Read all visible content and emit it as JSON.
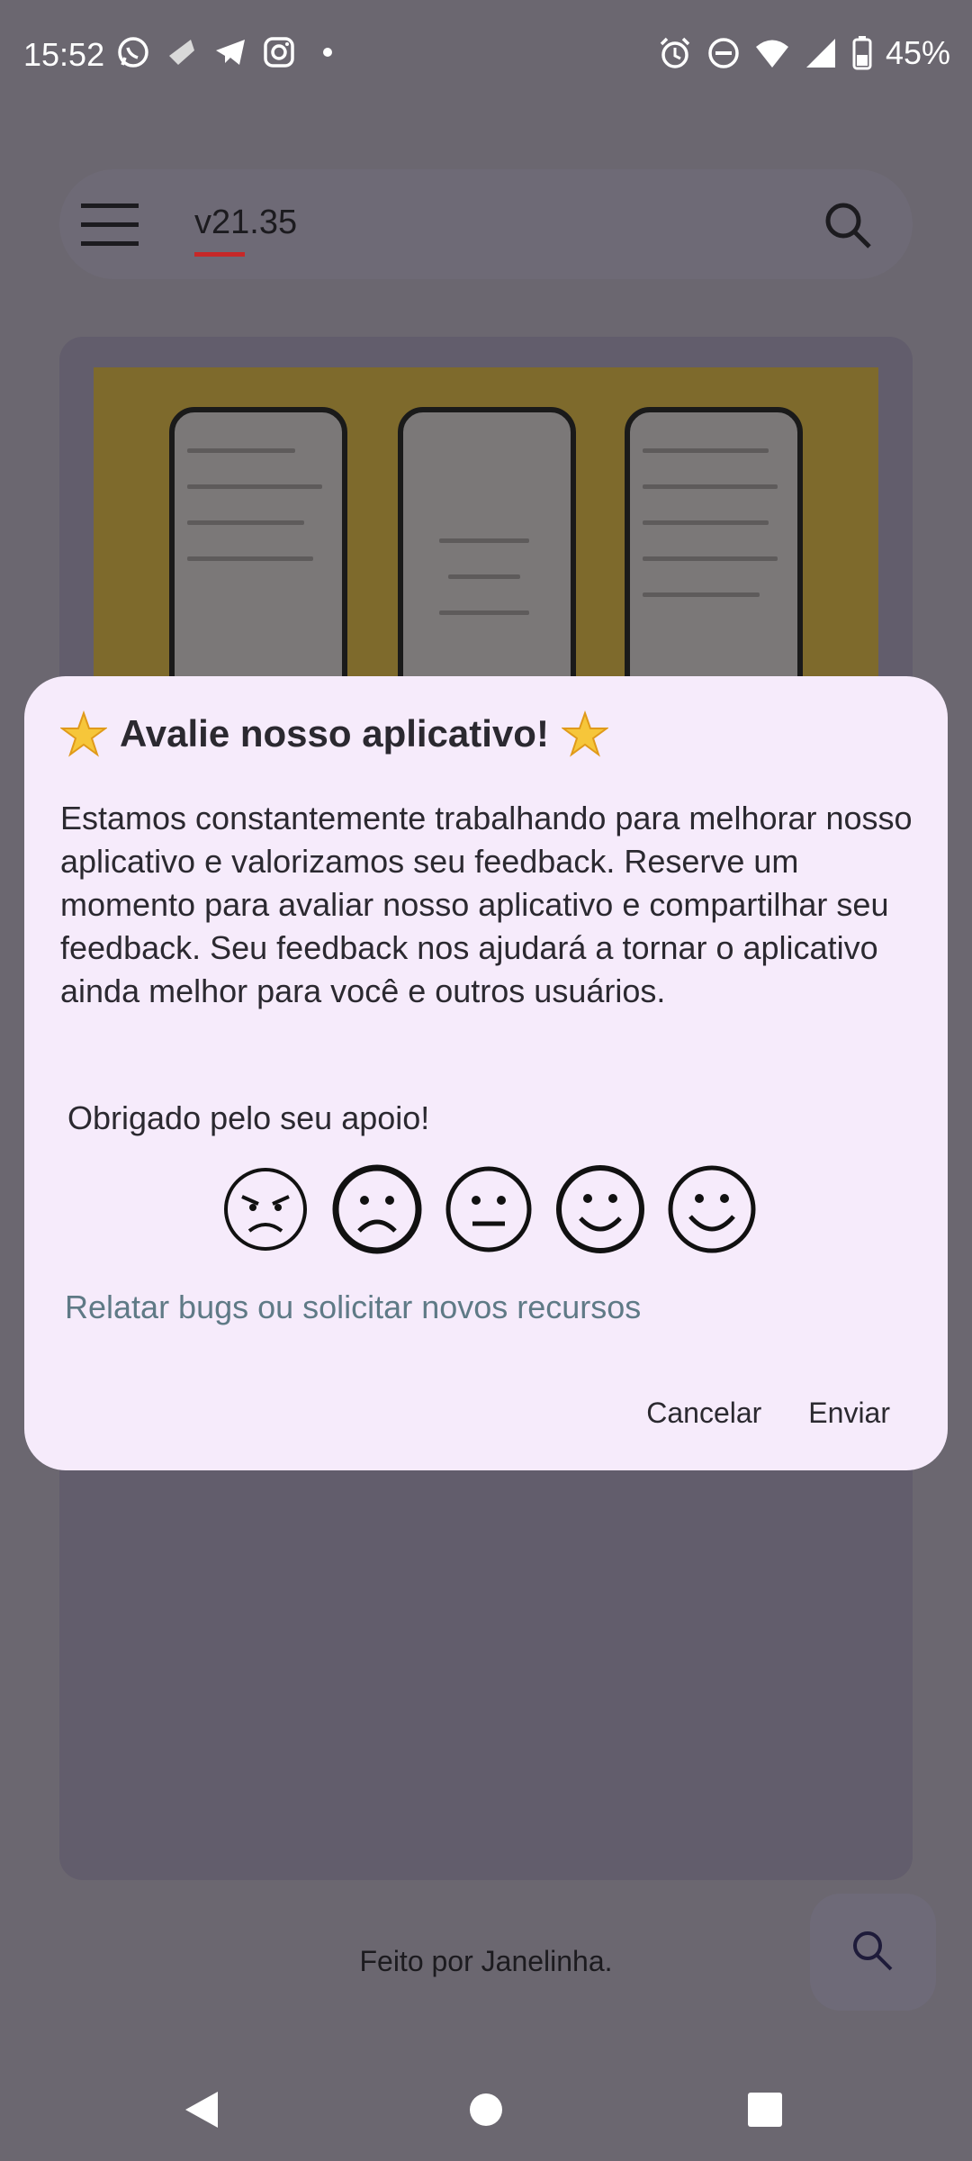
{
  "status_bar": {
    "time": "15:52",
    "battery": "45%",
    "left_icons": [
      "whatsapp-icon",
      "app-icon",
      "telegram-icon",
      "instagram-icon",
      "dot-icon"
    ],
    "right_icons": [
      "alarm-icon",
      "dnd-icon",
      "wifi-icon",
      "signal-icon",
      "battery-icon"
    ]
  },
  "search_bar": {
    "query": "v21.35",
    "menu_icon": "menu-icon",
    "search_icon": "search-icon"
  },
  "dialog": {
    "title": "Avalie nosso aplicativo!",
    "title_icon": "star-icon",
    "body": "Estamos constantemente trabalhando para melhorar nosso aplicativo e valorizamos seu feedback. Reserve um momento para avaliar nosso aplicativo e compartilhar seu feedback.  Seu feedback nos ajudará a tornar o aplicativo ainda melhor para você e outros usuários.",
    "thanks": "Obrigado pelo seu apoio!",
    "ratings": [
      "angry-face-icon",
      "sad-face-icon",
      "neutral-face-icon",
      "smile-face-icon",
      "happy-face-icon"
    ],
    "report_link": "Relatar bugs ou solicitar novos recursos",
    "cancel_label": "Cancelar",
    "send_label": "Enviar"
  },
  "footer": {
    "text": "Feito por Janelinha."
  },
  "colors": {
    "dialog_bg": "#f6ebfb",
    "link": "#5f7a86",
    "accent_underline": "#c62828",
    "banner_bg": "#7e6a2c"
  }
}
